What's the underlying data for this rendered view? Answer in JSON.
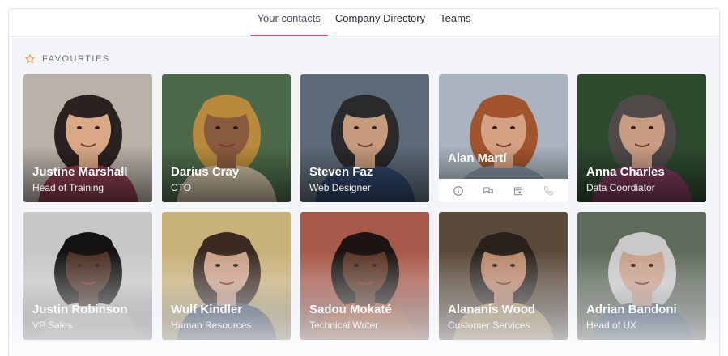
{
  "tabs": [
    {
      "label": "Your contacts",
      "active": true
    },
    {
      "label": "Company Directory",
      "active": false
    },
    {
      "label": "Teams",
      "active": false
    }
  ],
  "section": {
    "title": "FAVOURTIES",
    "icon": "star-outline-icon",
    "icon_color": "#f0a24b"
  },
  "accent_color": "#e0476f",
  "contacts": [
    {
      "name": "Justine Marshall",
      "role": "Head of Training",
      "bg": "#b9b2a8",
      "skin": "#d9a987",
      "hair": "#2a2220",
      "shirt": "#8a3d4d"
    },
    {
      "name": "Darius Cray",
      "role": "CTO",
      "bg": "#4c6a4a",
      "skin": "#8a5a3f",
      "hair": "#b98a3c",
      "shirt": "#c9b9a0"
    },
    {
      "name": "Steven Faz",
      "role": "Web Designer",
      "bg": "#5d6b79",
      "skin": "#c69a7c",
      "hair": "#2b2a2a",
      "shirt": "#2f4568"
    },
    {
      "name": "Alan Martí",
      "role": "",
      "bg": "#a9b4c0",
      "skin": "#d4a283",
      "hair": "#a2552c",
      "shirt": "#7f8e9c",
      "hovered": true
    },
    {
      "name": "Anna Charles",
      "role": "Data Coordiator",
      "bg": "#2d4a2f",
      "skin": "#c99c84",
      "hair": "#4f4a48",
      "shirt": "#7b3a59"
    },
    {
      "name": "Justin Robinson",
      "role": "VP Sales",
      "bg": "#c7c7c7",
      "skin": "#4a3024",
      "hair": "#151212",
      "shirt": "#d8d8d8"
    },
    {
      "name": "Wulf Kindler",
      "role": "Human Resources",
      "bg": "#c9b27a",
      "skin": "#caa088",
      "hair": "#3a2a22",
      "shirt": "#3e5170"
    },
    {
      "name": "Sadou Mokaté",
      "role": "Technical Writer",
      "bg": "#a85a4a",
      "skin": "#5a3626",
      "hair": "#1b1412",
      "shirt": "#c85f3a"
    },
    {
      "name": "Alananis Wood",
      "role": "Customer Services",
      "bg": "#5a4a3a",
      "skin": "#b9876a",
      "hair": "#2a211c",
      "shirt": "#caa56a"
    },
    {
      "name": "Adrian Bandoni",
      "role": "Head of UX",
      "bg": "#5f6a5a",
      "skin": "#c8a08a",
      "hair": "#c9c9c9",
      "shirt": "#3f5a7a"
    }
  ],
  "card_actions": [
    {
      "icon": "info-icon"
    },
    {
      "icon": "chat-icon"
    },
    {
      "icon": "calendar-icon"
    },
    {
      "icon": "phone-icon"
    }
  ]
}
